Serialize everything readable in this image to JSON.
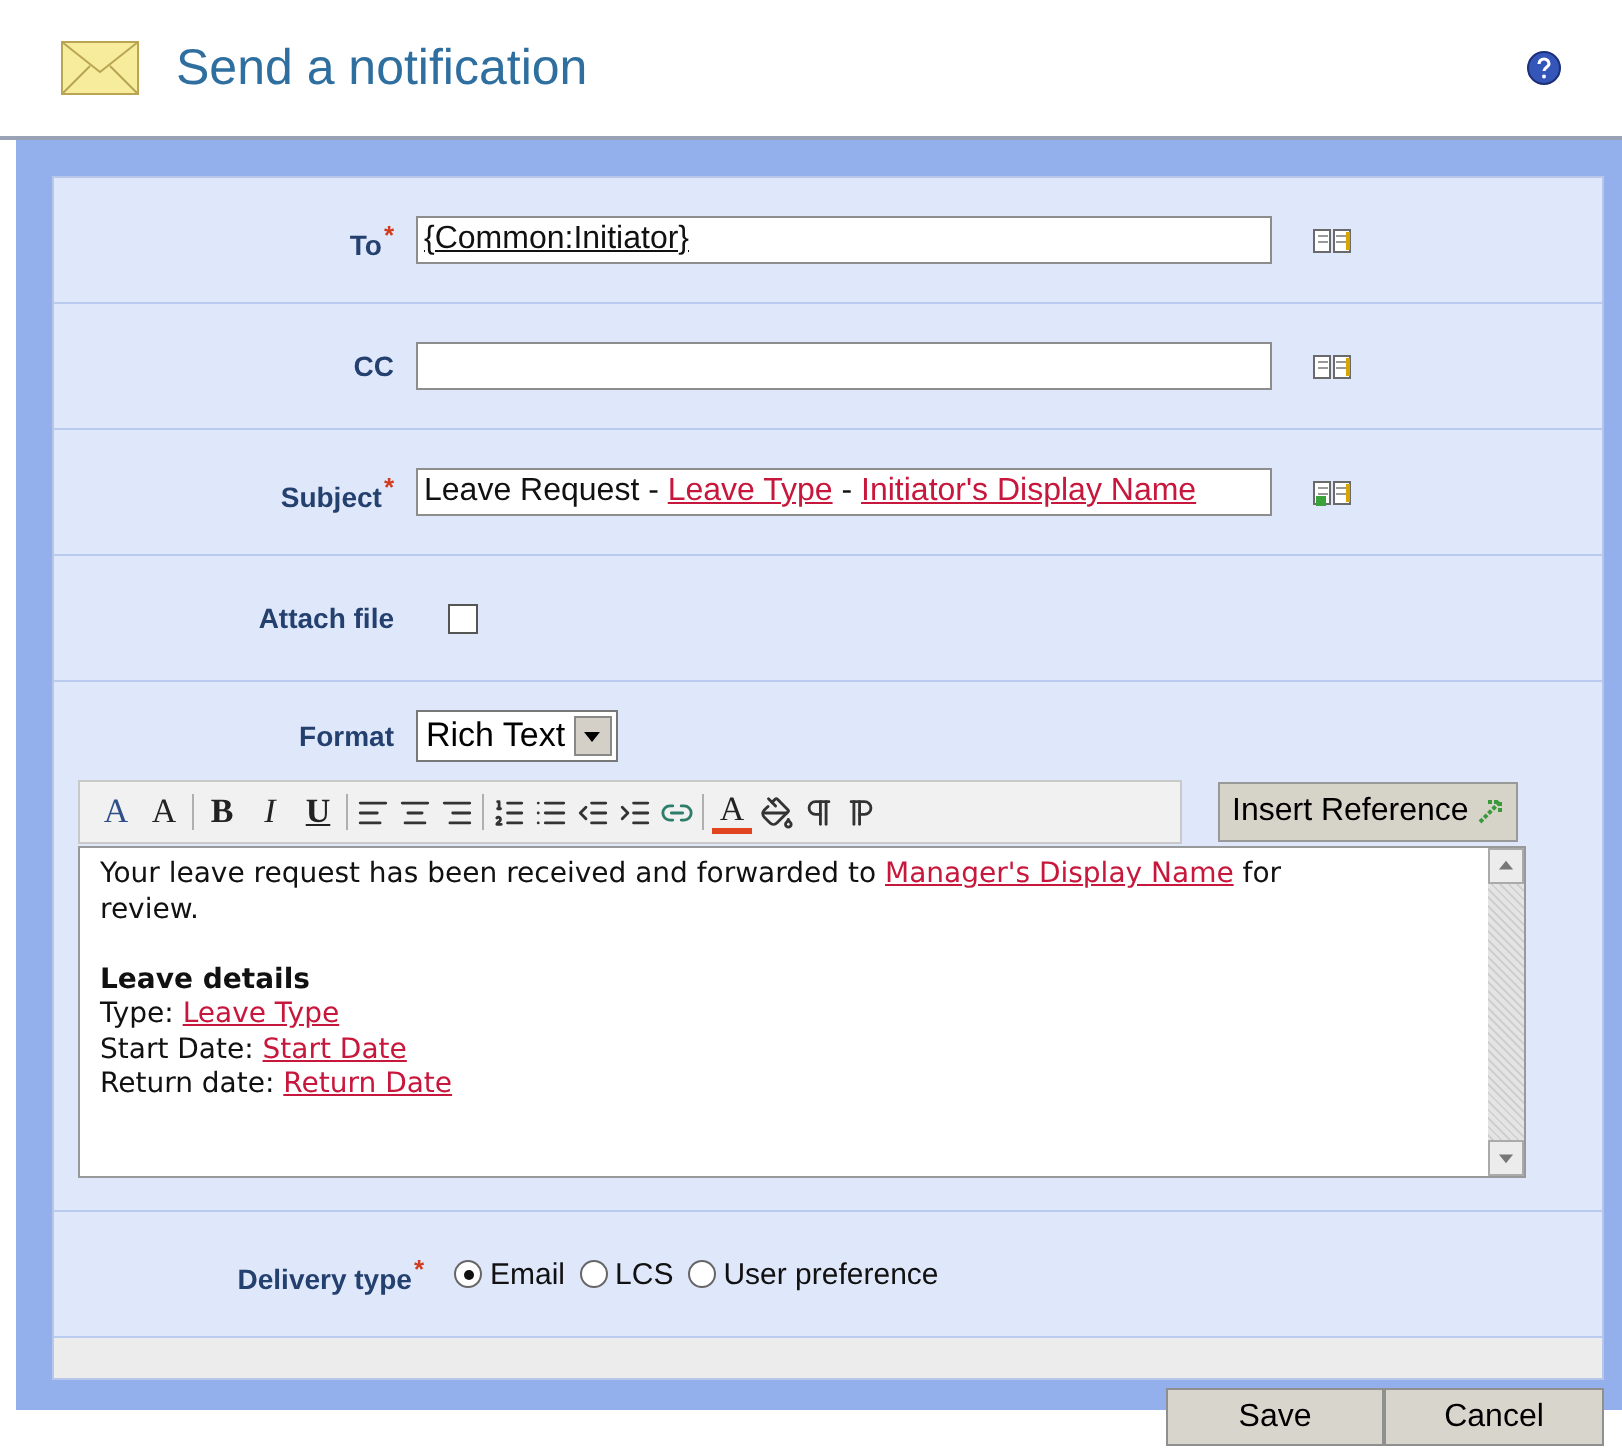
{
  "header": {
    "title": "Send a notification"
  },
  "to": {
    "label": "To",
    "required_mark": "*",
    "value": "{Common:Initiator}"
  },
  "cc": {
    "label": "CC"
  },
  "subject": {
    "label": "Subject",
    "required_mark": "*",
    "segments": [
      {
        "kind": "text",
        "text": "Leave Request - "
      },
      {
        "kind": "reference",
        "text": "Leave Type"
      },
      {
        "kind": "text",
        "text": " - "
      },
      {
        "kind": "reference",
        "text": "Initiator's Display Name"
      }
    ]
  },
  "attach": {
    "label": "Attach file",
    "checked": false
  },
  "format": {
    "label": "Format",
    "value": "Rich Text"
  },
  "toolbar": [
    {
      "kind": "font",
      "label": "A"
    },
    {
      "kind": "size",
      "label": "A"
    },
    {
      "kind": "sep"
    },
    {
      "kind": "bold",
      "label": "B"
    },
    {
      "kind": "italic",
      "label": "I"
    },
    {
      "kind": "underline",
      "label": "U"
    },
    {
      "kind": "sep"
    },
    {
      "kind": "left"
    },
    {
      "kind": "center"
    },
    {
      "kind": "right"
    },
    {
      "kind": "sep"
    },
    {
      "kind": "ordered"
    },
    {
      "kind": "bullets"
    },
    {
      "kind": "outdent"
    },
    {
      "kind": "indent"
    },
    {
      "kind": "link"
    },
    {
      "kind": "sep"
    },
    {
      "kind": "color",
      "label": "A"
    },
    {
      "kind": "fill"
    },
    {
      "kind": "ltr"
    },
    {
      "kind": "rtl"
    }
  ],
  "insert_reference": "Insert Reference",
  "body": [
    {
      "kind": "paragraph",
      "segments": [
        {
          "kind": "text",
          "text": "Your leave request has been received and forwarded to "
        },
        {
          "kind": "reference",
          "text": "Manager's Display Name"
        },
        {
          "kind": "text",
          "text": " for review."
        }
      ]
    },
    {
      "kind": "blank"
    },
    {
      "kind": "heading",
      "segments": [
        {
          "kind": "text",
          "text": "Leave details"
        }
      ]
    },
    {
      "kind": "paragraph",
      "segments": [
        {
          "kind": "text",
          "text": "Type: "
        },
        {
          "kind": "reference",
          "text": "Leave Type"
        }
      ]
    },
    {
      "kind": "paragraph",
      "segments": [
        {
          "kind": "text",
          "text": "Start Date: "
        },
        {
          "kind": "reference",
          "text": "Start Date"
        }
      ]
    },
    {
      "kind": "paragraph",
      "segments": [
        {
          "kind": "text",
          "text": "Return date: "
        },
        {
          "kind": "reference",
          "text": "Return Date"
        }
      ]
    }
  ],
  "delivery": {
    "label": "Delivery type",
    "required_mark": "*",
    "options": [
      {
        "label": "Email",
        "selected": true
      },
      {
        "label": "LCS",
        "selected": false
      },
      {
        "label": "User preference",
        "selected": false
      }
    ]
  },
  "buttons": [
    "Save",
    "Cancel"
  ]
}
